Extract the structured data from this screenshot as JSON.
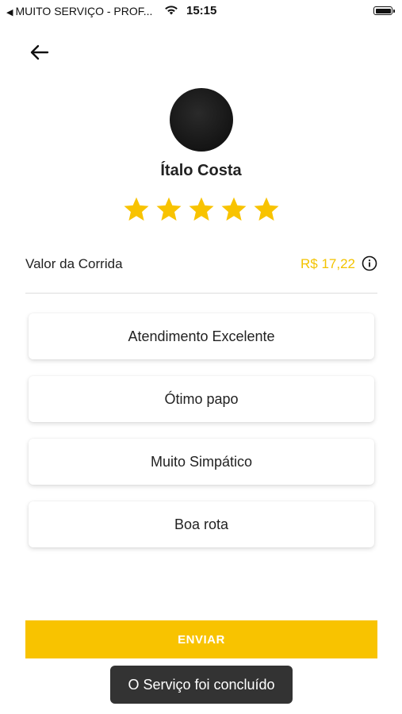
{
  "status_bar": {
    "carrier": "MUITO SERVIÇO - PROF...",
    "time": "15:15",
    "icons": [
      "back-to-app-triangle",
      "wifi-icon",
      "battery-icon"
    ]
  },
  "header": {
    "back_icon": "arrow-left-icon"
  },
  "driver": {
    "name": "Ítalo Costa",
    "avatar_color": "#111111"
  },
  "rating": {
    "value": 5,
    "max": 5,
    "star_color": "#F8C300"
  },
  "fare": {
    "label": "Valor da Corrida",
    "value": "R$ 17,22",
    "value_color": "#F3C300",
    "info_icon": "info-icon"
  },
  "options": [
    {
      "label": "Atendimento Excelente"
    },
    {
      "label": "Ótimo papo"
    },
    {
      "label": "Muito Simpático"
    },
    {
      "label": "Boa rota"
    }
  ],
  "submit": {
    "label": "ENVIAR",
    "color": "#F8C300"
  },
  "toast": {
    "message": "O Serviço foi concluído"
  }
}
